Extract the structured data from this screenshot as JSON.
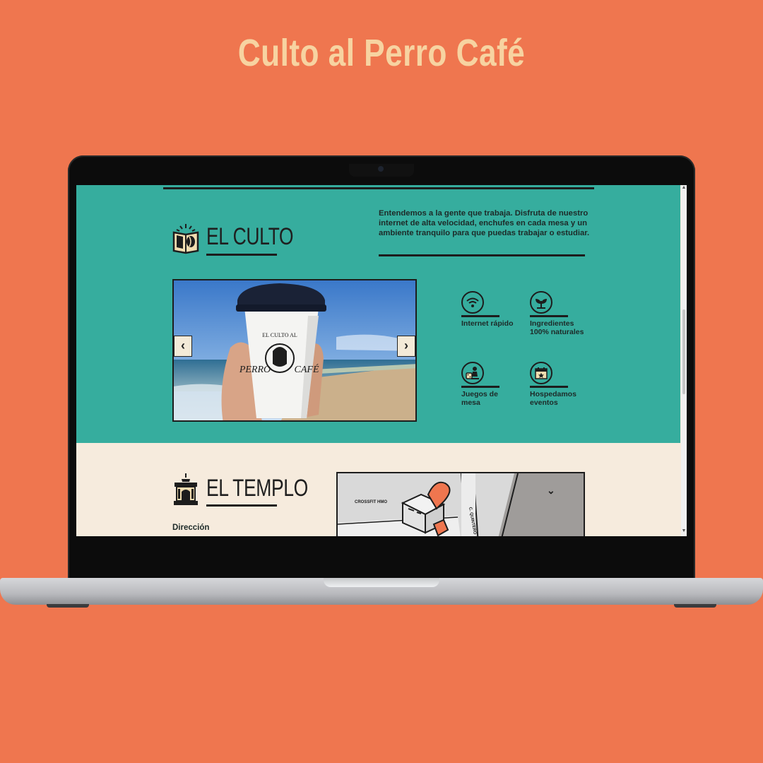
{
  "headline": "Culto al Perro Café",
  "culto": {
    "title": "EL CULTO",
    "intro": "Entendemos a la gente que trabaja. Disfruta de nuestro internet de alta velocidad, enchufes en cada mesa y un ambiente tranquilo para que puedas trabajar o estudiar.",
    "carousel": {
      "prev_label": "‹",
      "next_label": "›",
      "cup_text_top": "EL CULTO AL",
      "cup_text_left": "PERRO",
      "cup_text_right": "CAFÉ"
    },
    "features": [
      {
        "icon": "wifi-icon",
        "label": "Internet rápido"
      },
      {
        "icon": "leaves-icon",
        "label": "Ingredientes 100% naturales"
      },
      {
        "icon": "board-game-icon",
        "label": "Juegos de mesa"
      },
      {
        "icon": "calendar-star-icon",
        "label": "Hospedamos eventos"
      }
    ]
  },
  "templo": {
    "title": "EL TEMPLO",
    "address_label": "Dirección",
    "map": {
      "label_gym": "CROSSFIT HMO",
      "label_street": "C. QUINTERO",
      "toggle_label": "⌄"
    }
  },
  "colors": {
    "background": "#ef764f",
    "teal": "#36ad9e",
    "cream": "#f6ebdd",
    "headline": "#f7d3a1",
    "dark": "#1d1d1d"
  }
}
